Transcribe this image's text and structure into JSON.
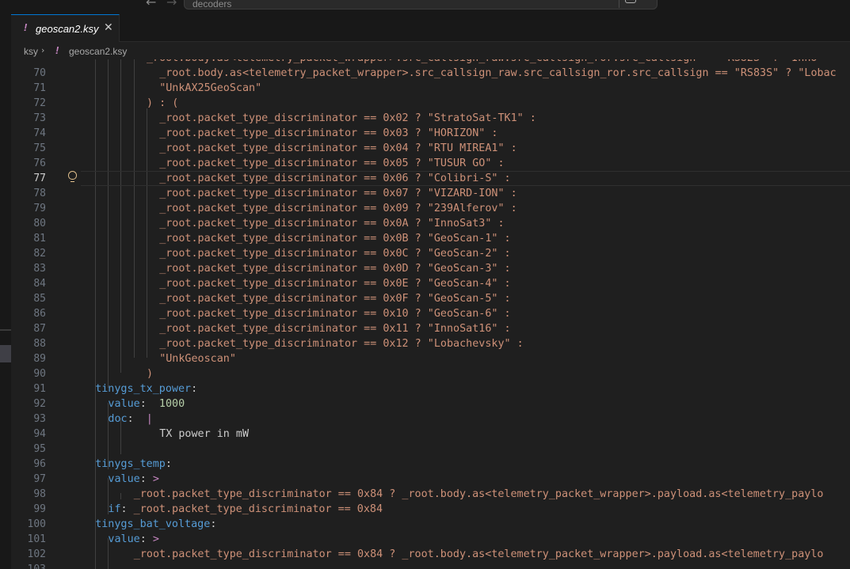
{
  "titlebar": {
    "search_text": "decoders",
    "back_icon": "arrow-left-icon",
    "forward_icon": "arrow-right-icon"
  },
  "tab": {
    "icon": "!",
    "label": "geoscan2.ksy",
    "close": "✕"
  },
  "breadcrumb": {
    "root": "ksy",
    "separator": "›",
    "file_icon": "!",
    "file": "geoscan2.ksy"
  },
  "editor": {
    "current_line": 77,
    "lines": [
      {
        "n": "",
        "code": "_root.body.as<telemetry_packet_wrapper>.src_callsign_raw.src_callsign_ror.src_callsign == \"RS82S\" ? \"Inno"
      },
      {
        "n": "70",
        "code": "_root.body.as<telemetry_packet_wrapper>.src_callsign_raw.src_callsign_ror.src_callsign == \"RS83S\" ? \"Lobac"
      },
      {
        "n": "71",
        "code": "\"UnkAX25GeoScan\""
      },
      {
        "n": "72",
        "code": ") : ("
      },
      {
        "n": "73",
        "code": "_root.packet_type_discriminator == 0x02 ? \"StratoSat-TK1\" :"
      },
      {
        "n": "74",
        "code": "_root.packet_type_discriminator == 0x03 ? \"HORIZON\" :"
      },
      {
        "n": "75",
        "code": "_root.packet_type_discriminator == 0x04 ? \"RTU MIREA1\" :"
      },
      {
        "n": "76",
        "code": "_root.packet_type_discriminator == 0x05 ? \"TUSUR GO\" :"
      },
      {
        "n": "77",
        "code": "_root.packet_type_discriminator == 0x06 ? \"Colibri-S\" :"
      },
      {
        "n": "78",
        "code": "_root.packet_type_discriminator == 0x07 ? \"VIZARD-ION\" :"
      },
      {
        "n": "79",
        "code": "_root.packet_type_discriminator == 0x09 ? \"239Alferov\" :"
      },
      {
        "n": "80",
        "code": "_root.packet_type_discriminator == 0x0A ? \"InnoSat3\" :"
      },
      {
        "n": "81",
        "code": "_root.packet_type_discriminator == 0x0B ? \"GeoScan-1\" :"
      },
      {
        "n": "82",
        "code": "_root.packet_type_discriminator == 0x0C ? \"GeoScan-2\" :"
      },
      {
        "n": "83",
        "code": "_root.packet_type_discriminator == 0x0D ? \"GeoScan-3\" :"
      },
      {
        "n": "84",
        "code": "_root.packet_type_discriminator == 0x0E ? \"GeoScan-4\" :"
      },
      {
        "n": "85",
        "code": "_root.packet_type_discriminator == 0x0F ? \"GeoScan-5\" :"
      },
      {
        "n": "86",
        "code": "_root.packet_type_discriminator == 0x10 ? \"GeoScan-6\" :"
      },
      {
        "n": "87",
        "code": "_root.packet_type_discriminator == 0x11 ? \"InnoSat16\" :"
      },
      {
        "n": "88",
        "code": "_root.packet_type_discriminator == 0x12 ? \"Lobachevsky\" :"
      },
      {
        "n": "89",
        "code": "\"UnkGeoscan\""
      },
      {
        "n": "90",
        "code": ")"
      },
      {
        "n": "91",
        "key": "tinygs_tx_power",
        "tail": ":"
      },
      {
        "n": "92",
        "key": "value",
        "tail": ":  ",
        "num": "1000"
      },
      {
        "n": "93",
        "key": "doc",
        "tail": ":  ",
        "pipe": "|"
      },
      {
        "n": "94",
        "text": "TX power in mW"
      },
      {
        "n": "95",
        "code": ""
      },
      {
        "n": "96",
        "key": "tinygs_temp",
        "tail": ":"
      },
      {
        "n": "97",
        "key": "value",
        "tail": ": ",
        "pipe": ">"
      },
      {
        "n": "98",
        "code": "_root.packet_type_discriminator == 0x84 ? _root.body.as<telemetry_packet_wrapper>.payload.as<telemetry_paylo"
      },
      {
        "n": "99",
        "key": "if",
        "tail": ": ",
        "code_inline": "_root.packet_type_discriminator == 0x84"
      },
      {
        "n": "100",
        "key": "tinygs_bat_voltage",
        "tail": ":"
      },
      {
        "n": "101",
        "key": "value",
        "tail": ": ",
        "pipe": ">"
      },
      {
        "n": "102",
        "code": "_root.packet_type_discriminator == 0x84 ? _root.body.as<telemetry_packet_wrapper>.payload.as<telemetry_paylo"
      },
      {
        "n": "103",
        "code": ""
      }
    ]
  }
}
